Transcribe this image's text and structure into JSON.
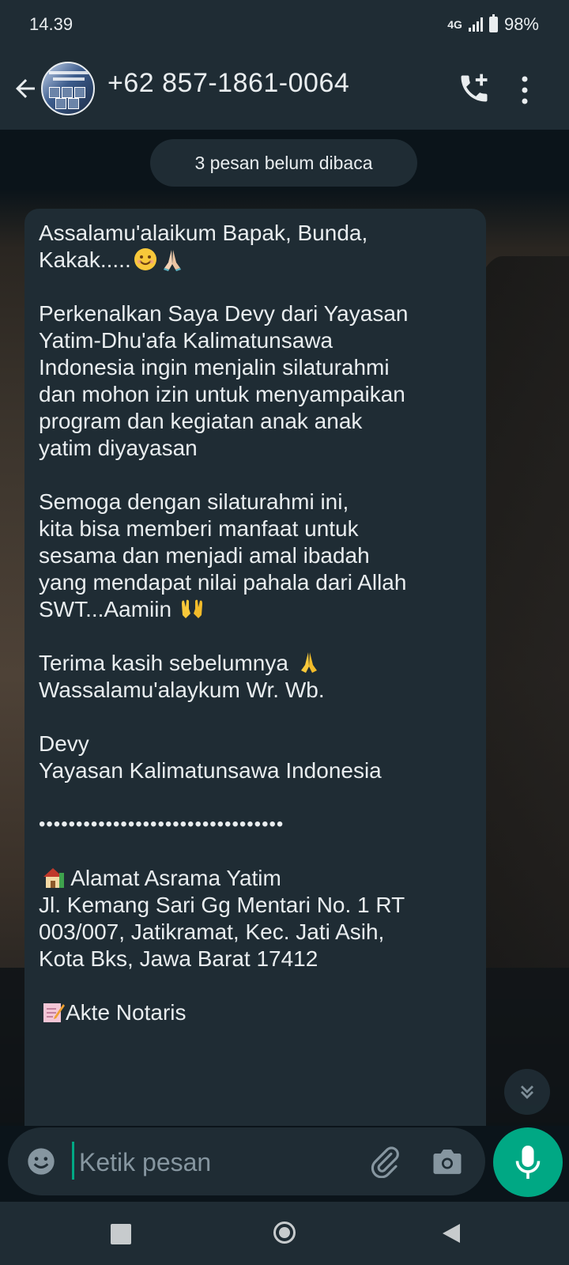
{
  "status_bar": {
    "time": "14.39",
    "network": "4G",
    "battery": "98%"
  },
  "header": {
    "contact_name": "+62 857-1861-0064"
  },
  "chat": {
    "unread_label": "3 pesan belum dibaca",
    "message": {
      "l1": "Assalamu'alaikum Bapak, Bunda,",
      "l2": "Kakak.....",
      "l3a": "Perkenalkan Saya ",
      "l3b": "Devy",
      "l3c": " dari Yayasan",
      "l4": "Yatim-Dhu'afa Kalimatunsawa",
      "l5a": "Indonesia ingin menjalin ",
      "l5b": "silaturahmi",
      "l6": "dan mohon izin untuk menyampaikan",
      "l7": "program dan kegiatan anak anak",
      "l8": "yatim diyayasan",
      "l9": "Semoga dengan silaturahmi ini,",
      "l10": "kita bisa memberi manfaat untuk",
      "l11": "sesama dan menjadi amal ibadah",
      "l12": "yang mendapat nilai pahala dari Allah",
      "l13": "SWT...Aamiin",
      "l14": "Terima kasih sebelumnya",
      "l15": "Wassalamu'alaykum Wr. Wb.",
      "l16": "Devy",
      "l17": "Yayasan Kalimatunsawa Indonesia",
      "l18": "•••••••••••••••••••••••••••••••••",
      "l19": "Alamat Asrama Yatim",
      "l20": "Jl. Kemang Sari Gg Mentari No. 1 RT",
      "l21": "003/007, Jatikramat, Kec. Jati Asih,",
      "l22": "Kota Bks, Jawa Barat 17412",
      "l23": "Akte Notaris"
    }
  },
  "composer": {
    "placeholder": "Ketik pesan"
  },
  "icons": {
    "back": "arrow-left-icon",
    "call_add": "phone-plus-icon",
    "menu": "more-vert-icon",
    "emoji": "emoji-icon",
    "attach": "paperclip-icon",
    "camera": "camera-icon",
    "mic": "mic-icon",
    "scroll_down": "double-chevron-down-icon"
  },
  "colors": {
    "accent": "#00a884",
    "bar": "#1f2c34",
    "bubble": "#1f2c34"
  }
}
